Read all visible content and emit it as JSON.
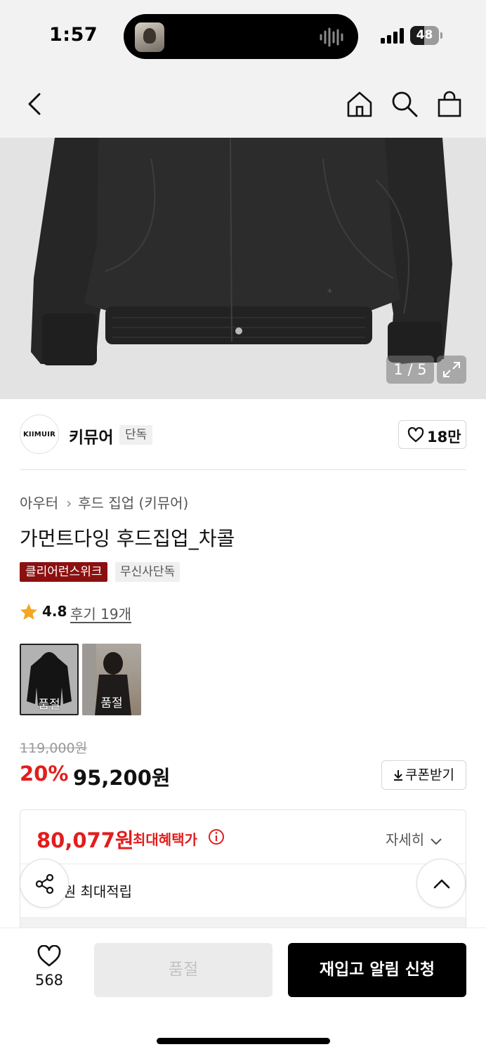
{
  "status_bar": {
    "time": "1:57",
    "battery": "48",
    "battery_level": 0.48
  },
  "nav": {
    "icons": [
      "back-icon",
      "home-icon",
      "search-icon",
      "shopping-bag-icon"
    ]
  },
  "gallery": {
    "counter": "1 / 5"
  },
  "brand": {
    "logo_text": "KIIMUIR",
    "name": "키뮤어",
    "badge": "단독",
    "likes": "18만"
  },
  "product": {
    "breadcrumb": [
      "아우터",
      "후드 집업 (키뮤어)"
    ],
    "title": "가먼트다잉 후드집업_차콜",
    "tags": [
      "클리어런스위크",
      "무신사단독"
    ],
    "rating": "4.8",
    "review_link": "후기 19개"
  },
  "options": [
    {
      "label": "품절"
    },
    {
      "label": "품절"
    }
  ],
  "price": {
    "original": "119,000원",
    "discount": "20%",
    "sale": "95,200원",
    "coupon_label": "쿠폰받기"
  },
  "benefit": {
    "max_price": "80,077원",
    "max_label": "최대혜택가",
    "detail_label": "자세히",
    "points_text": "0원 최대적립"
  },
  "bottom_bar": {
    "wish_count": "568",
    "soldout_label": "품절",
    "restock_label": "재입고 알림 신청"
  },
  "colors": {
    "accent_red": "#e21d1d",
    "tag_red": "#8b1010",
    "button_black": "#000000"
  }
}
